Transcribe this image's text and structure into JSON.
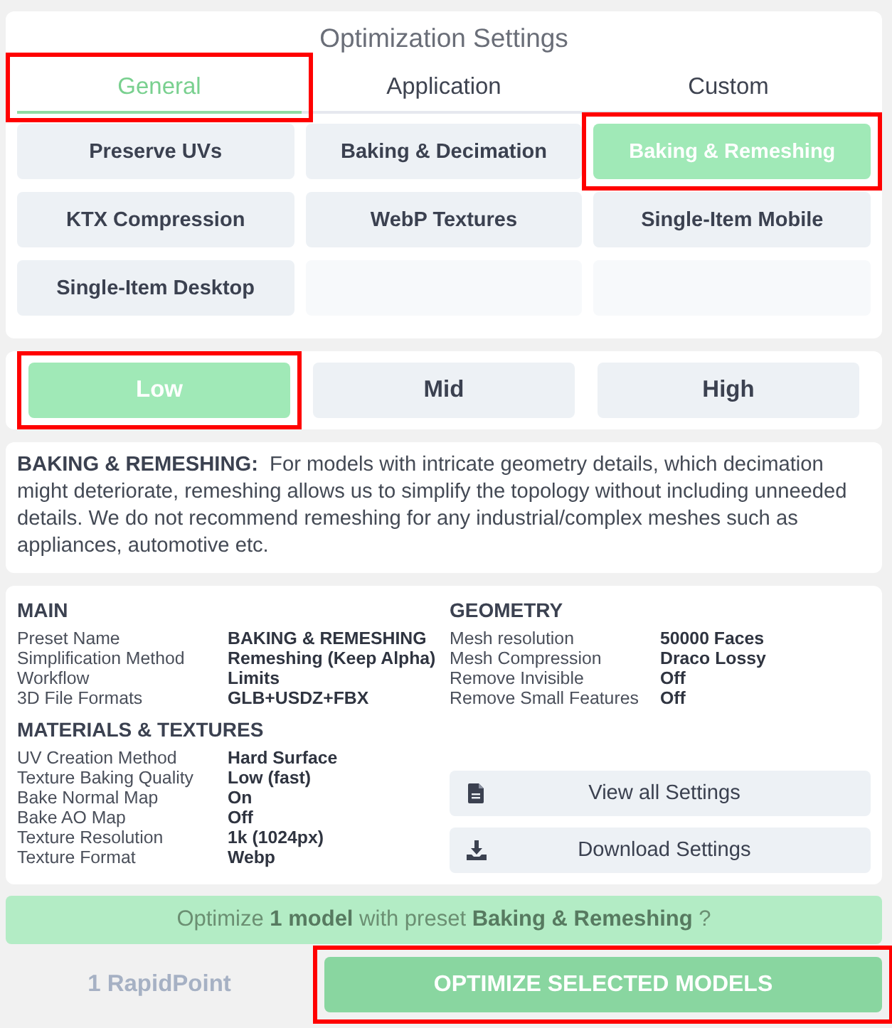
{
  "title": "Optimization Settings",
  "tabs": [
    {
      "label": "General",
      "selected": true,
      "highlighted": true
    },
    {
      "label": "Application",
      "selected": false,
      "highlighted": false
    },
    {
      "label": "Custom",
      "selected": false,
      "highlighted": false
    }
  ],
  "presets": [
    {
      "kind": "preset",
      "label": "Preserve UVs",
      "selected": false,
      "highlighted": false
    },
    {
      "kind": "preset",
      "label": "Baking & Decimation",
      "selected": false,
      "highlighted": false
    },
    {
      "kind": "preset",
      "label": "Baking & Remeshing",
      "selected": true,
      "highlighted": true
    },
    {
      "kind": "preset",
      "label": "KTX Compression",
      "selected": false,
      "highlighted": false
    },
    {
      "kind": "preset",
      "label": "WebP Textures",
      "selected": false,
      "highlighted": false
    },
    {
      "kind": "preset",
      "label": "Single-Item Mobile",
      "selected": false,
      "highlighted": false
    },
    {
      "kind": "preset",
      "label": "Single-Item Desktop",
      "selected": false,
      "highlighted": false
    },
    {
      "kind": "empty"
    },
    {
      "kind": "empty"
    }
  ],
  "quality_levels": [
    {
      "label": "Low",
      "selected": true,
      "highlighted": true
    },
    {
      "label": "Mid",
      "selected": false,
      "highlighted": false
    },
    {
      "label": "High",
      "selected": false,
      "highlighted": false
    }
  ],
  "description": "**BAKING & REMESHING:**  For models with intricate geometry details, which decimation might deteriorate, remeshing allows us to simplify the topology without including unneeded details. We do not recommend remeshing for any industrial/complex meshes such as appliances, automotive etc.",
  "main": {
    "heading": "MAIN",
    "rows": [
      {
        "label": "Preset Name",
        "value": "BAKING & REMESHING"
      },
      {
        "label": "Simplification Method",
        "value": "Remeshing (Keep Alpha)"
      },
      {
        "label": "Workflow",
        "value": "Limits"
      },
      {
        "label": "3D File Formats",
        "value": "GLB+USDZ+FBX"
      }
    ]
  },
  "geometry": {
    "heading": "GEOMETRY",
    "rows": [
      {
        "label": "Mesh resolution",
        "value": "50000 Faces"
      },
      {
        "label": "Mesh Compression",
        "value": "Draco Lossy"
      },
      {
        "label": "Remove Invisible",
        "value": "Off"
      },
      {
        "label": "Remove Small Features",
        "value": "Off"
      }
    ]
  },
  "materials": {
    "heading": "MATERIALS & TEXTURES",
    "rows": [
      {
        "label": "UV Creation Method",
        "value": "Hard Surface"
      },
      {
        "label": "Texture Baking Quality",
        "value": "Low (fast)"
      },
      {
        "label": "Bake Normal Map",
        "value": "On"
      },
      {
        "label": "Bake AO Map",
        "value": "Off"
      },
      {
        "label": "Texture Resolution",
        "value": "1k (1024px)"
      },
      {
        "label": "Texture Format",
        "value": "Webp"
      }
    ]
  },
  "actions": [
    {
      "kind": "document",
      "label": "View all Settings"
    },
    {
      "kind": "download",
      "label": "Download Settings"
    }
  ],
  "summary": "Optimize **1 model** with preset **Baking & Remeshing** ?",
  "footer": {
    "points": "1 RapidPoint",
    "button": {
      "label": "OPTIMIZE SELECTED MODELS",
      "highlighted": true
    }
  }
}
